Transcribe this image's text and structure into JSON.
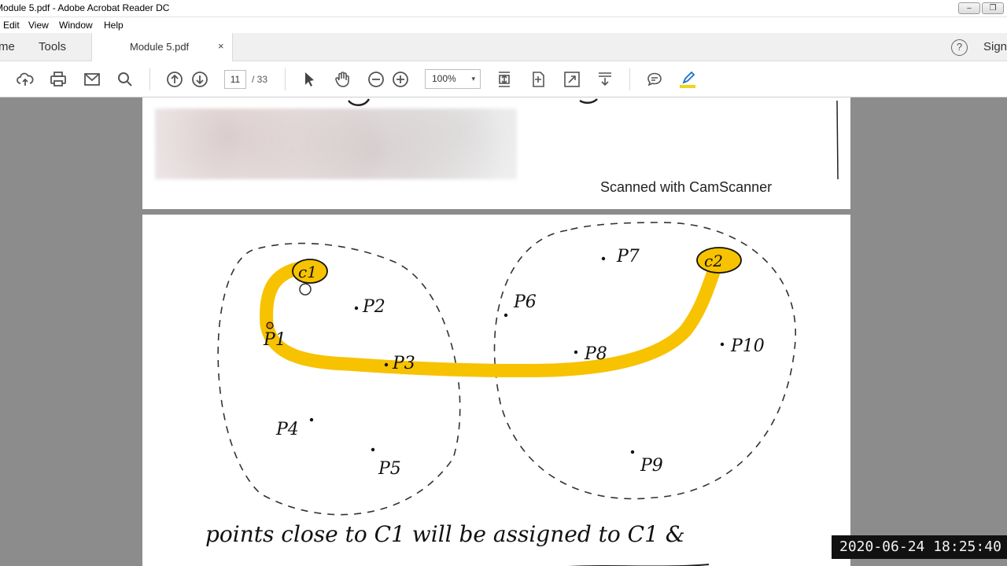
{
  "window": {
    "title": "Module 5.pdf - Adobe Acrobat Reader DC",
    "minimize": "–",
    "restore": "❐"
  },
  "menu": {
    "items": [
      "Edit",
      "View",
      "Window",
      "Help"
    ]
  },
  "tabs": {
    "home": "me",
    "tools": "Tools",
    "document": "Module 5.pdf",
    "close": "×",
    "help": "?",
    "sign_in": "Sign"
  },
  "toolbar": {
    "current_page": "11",
    "total_pages": "/ 33",
    "zoom": "100%",
    "zoom_caret": "▾",
    "icons": [
      "upload-icon",
      "print-icon",
      "email-icon",
      "search-icon",
      "page-up-icon",
      "page-down-icon",
      "select-cursor-icon",
      "hand-tool-icon",
      "zoom-out-icon",
      "zoom-in-icon",
      "scroll-mode-icon",
      "fit-page-icon",
      "full-screen-icon",
      "download-icon",
      "comment-icon",
      "highlight-icon"
    ]
  },
  "document": {
    "page1_footer": "Scanned with CamScanner",
    "clusters": {
      "c1": "c1",
      "c2": "c2"
    },
    "points": [
      "P1",
      "P2",
      "P3",
      "P4",
      "P5",
      "P6",
      "P7",
      "P8",
      "P9",
      "P10"
    ],
    "handwritten_line": "points close to C1 will be assigned to C1 &"
  },
  "colors": {
    "highlight": "#f7c200",
    "accent": "#1a73c8"
  },
  "overlay": {
    "timestamp": "2020-06-24 18:25:40"
  }
}
